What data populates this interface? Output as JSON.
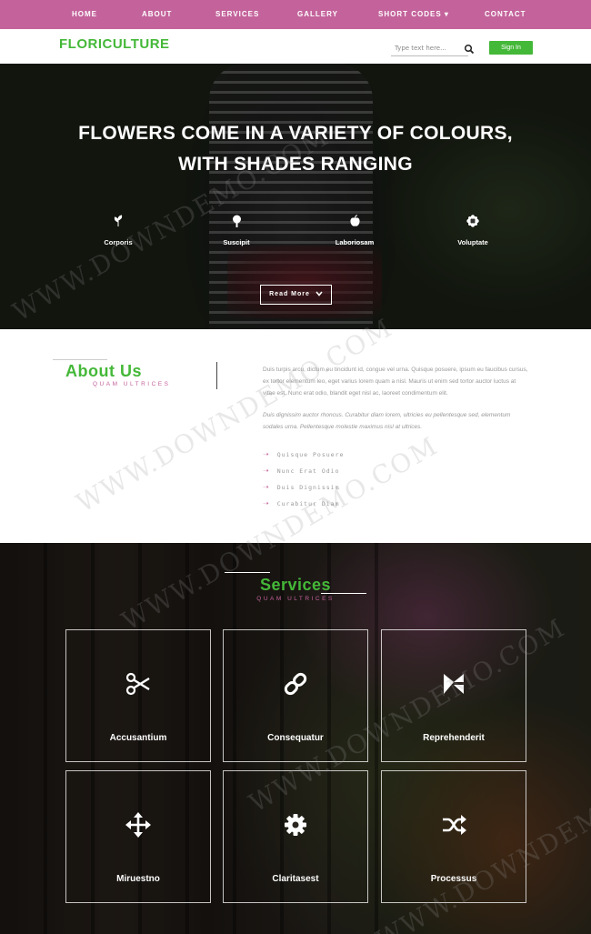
{
  "nav": {
    "items": [
      {
        "label": "HOME"
      },
      {
        "label": "ABOUT"
      },
      {
        "label": "SERVICES"
      },
      {
        "label": "GALLERY"
      },
      {
        "label": "SHORT CODES ▾"
      },
      {
        "label": "CONTACT"
      }
    ]
  },
  "header": {
    "logo": "FLORICULTURE",
    "search_placeholder": "Type text here...",
    "search_icon": "search-icon",
    "signin_label": "Sign In"
  },
  "hero": {
    "title_line1": "FLOWERS COME IN A VARIETY OF COLOURS,",
    "title_line2": "WITH SHADES RANGING",
    "features": [
      {
        "icon": "leaf-icon",
        "label": "Corporis"
      },
      {
        "icon": "tree-icon",
        "label": "Suscipit"
      },
      {
        "icon": "apple-icon",
        "label": "Laboriosam"
      },
      {
        "icon": "flower-icon",
        "label": "Voluptate"
      }
    ],
    "read_more_label": "Read More",
    "read_more_icon": "chevron-down-icon"
  },
  "about": {
    "title": "About Us",
    "subtitle": "QUAM ULTRICES",
    "paragraph1": "Duis turpis arcu, dictum eu tincidunt id, congue vel urna. Quisque posuere, ipsum eu faucibus cursus, ex tortor elementum leo, eget varius lorem quam a nisl. Mauris ut enim sed tortor auctor luctus at vitae est. Nunc erat odio, blandit eget nisl ac, laoreet condimentum elit.",
    "paragraph2": "Duis dignissim auctor rhoncus. Curabitur diam lorem, ultricies eu pellentesque sed, elementum sodales urna. Pellentesque molestie maximus nisl at ultrices.",
    "list": [
      {
        "label": "Quisque Posuere"
      },
      {
        "label": "Nunc Erat Odio"
      },
      {
        "label": "Duis Dignissim"
      },
      {
        "label": "Curabitur Diam"
      }
    ]
  },
  "services": {
    "title": "Services",
    "subtitle": "QUAM ULTRICES",
    "items": [
      {
        "icon": "scissors-icon",
        "label": "Accusantium"
      },
      {
        "icon": "link-icon",
        "label": "Consequatur"
      },
      {
        "icon": "envira-icon",
        "label": "Reprehenderit"
      },
      {
        "icon": "move-arrows-icon",
        "label": "Miruestno"
      },
      {
        "icon": "gear-icon",
        "label": "Claritasest"
      },
      {
        "icon": "shuffle-icon",
        "label": "Processus"
      }
    ]
  },
  "watermark": "WWW.DOWNDEMO.COM",
  "colors": {
    "nav_bg": "#c4639b",
    "brand_green": "#44b838",
    "accent_pink": "#c4639b"
  }
}
